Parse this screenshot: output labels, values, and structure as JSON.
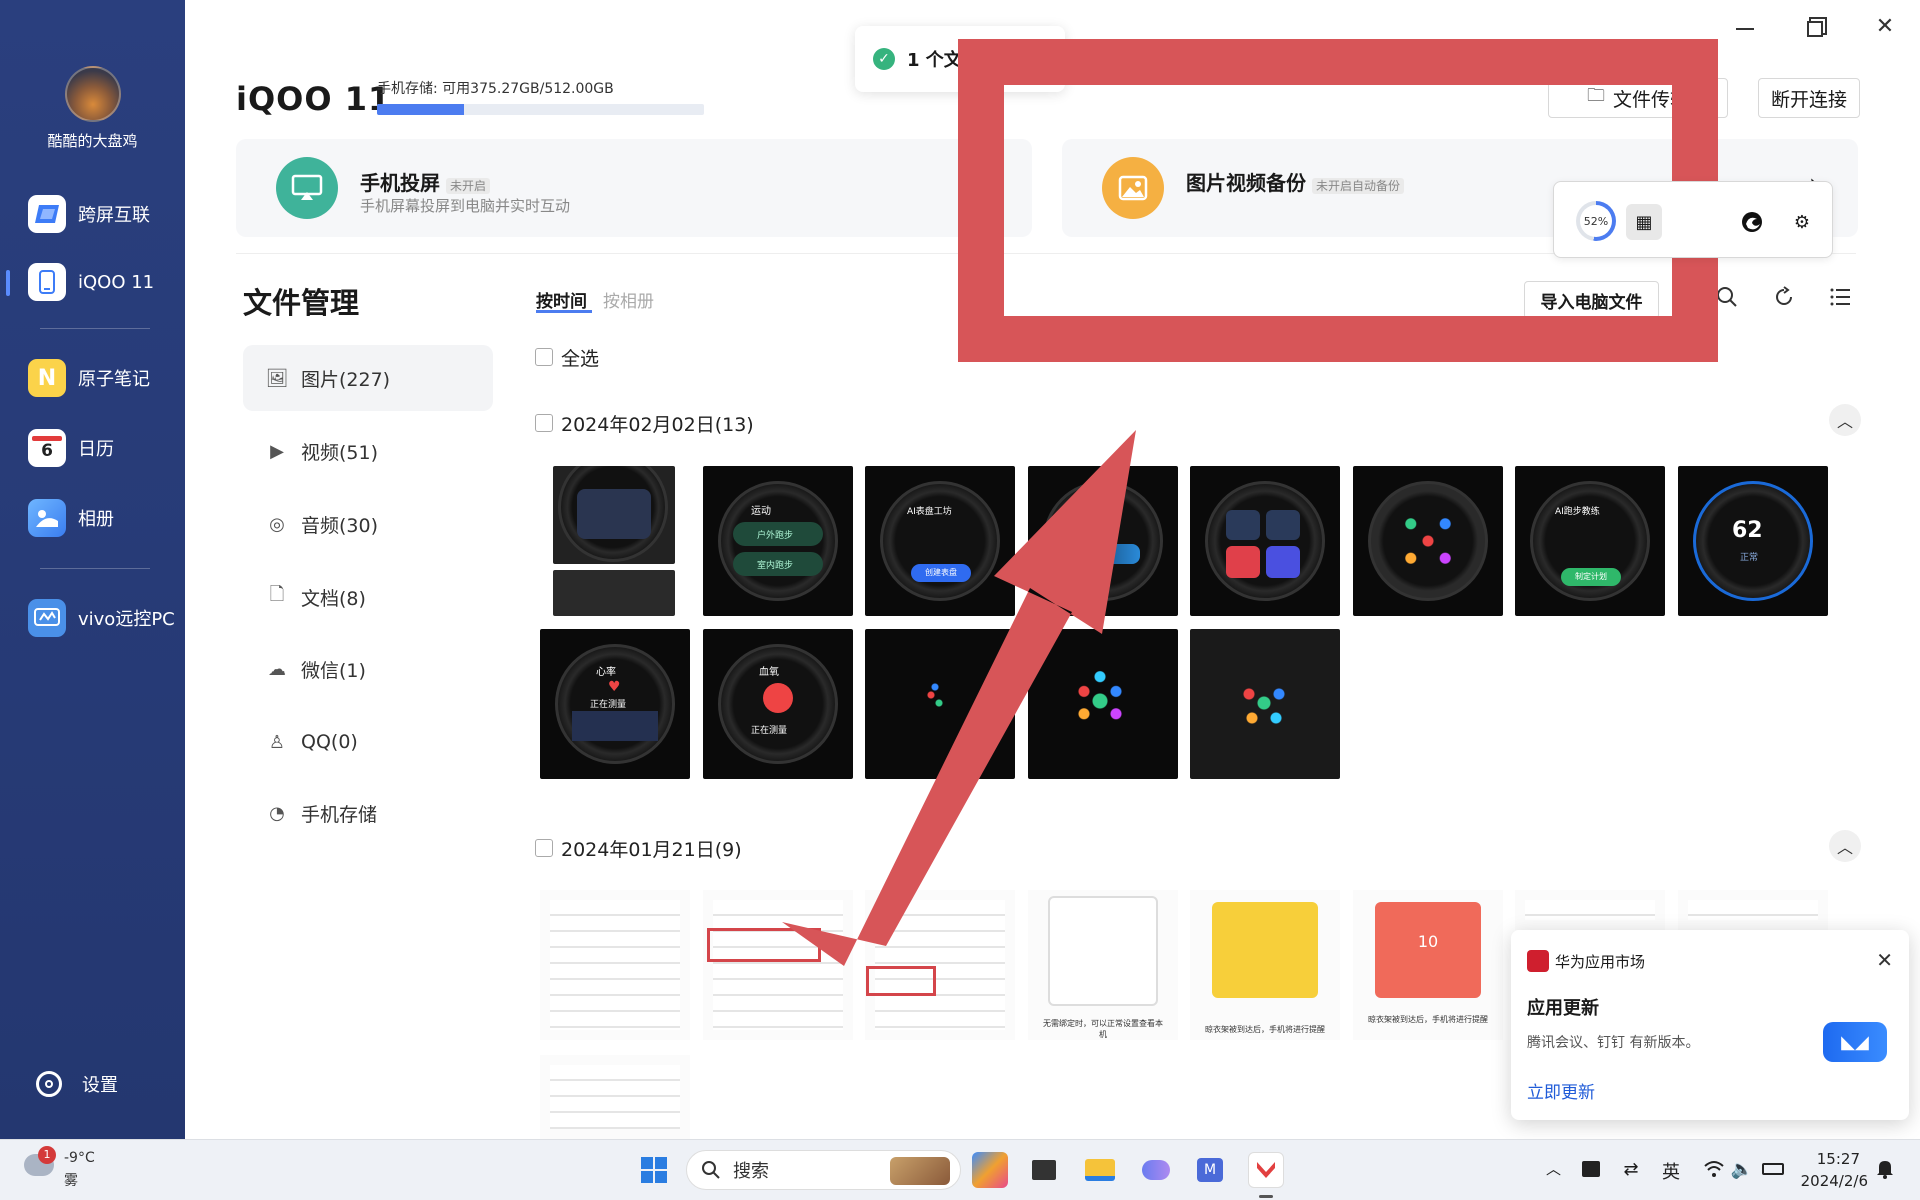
{
  "sidebar": {
    "username": "酷酷的大盘鸡",
    "items": [
      {
        "label": "跨屏互联",
        "icon": "cross-screen-icon"
      },
      {
        "label": "iQOO 11",
        "icon": "phone-icon"
      },
      {
        "label": "原子笔记",
        "icon": "notes-icon"
      },
      {
        "label": "日历",
        "icon": "calendar-icon",
        "day": "6"
      },
      {
        "label": "相册",
        "icon": "album-icon"
      },
      {
        "label": "vivo远控PC",
        "icon": "remote-pc-icon"
      }
    ],
    "settings_label": "设置"
  },
  "header": {
    "device_name": "iQOO 11",
    "storage_text": "手机存储: 可用375.27GB/512.00GB",
    "storage_used_fraction": 0.267,
    "file_transfer_label": "文件传输",
    "disconnect_label": "断开连接"
  },
  "toast": {
    "text": "1 个文"
  },
  "cards": {
    "screen_mirror": {
      "title": "手机投屏",
      "badge": "未开启",
      "subtitle": "手机屏幕投屏到电脑并实时互动"
    },
    "backup": {
      "title": "图片视频备份",
      "badge": "未开启自动备份"
    }
  },
  "popup": {
    "percent": "52%"
  },
  "file_manager": {
    "title": "文件管理",
    "items": [
      {
        "label": "图片(227)"
      },
      {
        "label": "视频(51)"
      },
      {
        "label": "音频(30)"
      },
      {
        "label": "文档(8)"
      },
      {
        "label": "微信(1)"
      },
      {
        "label": "QQ(0)"
      },
      {
        "label": "手机存储"
      }
    ]
  },
  "main": {
    "tabs": [
      {
        "label": "按时间"
      },
      {
        "label": "按相册"
      }
    ],
    "import_label": "导入电脑文件",
    "select_all": "全选",
    "groups": [
      {
        "date": "2024年02月02日(13)"
      },
      {
        "date": "2024年01月21日(9)"
      }
    ],
    "watch_texts": {
      "run": "运动",
      "outdoor": "户外跑步",
      "indoor": "室内跑步",
      "ai_face": "AI表盘工坊",
      "ai_face_btn": "创建表盘",
      "ai_run": "AI跑步教练",
      "ai_run_btn": "制定计划",
      "steps_value": "62",
      "steps_status": "正常",
      "heart": "心率",
      "heart_status": "正在测量",
      "spo2": "血氧",
      "spo2_status": "正在测量"
    },
    "doc_captions": [
      "无需绑定时，可以正常设置查看本机",
      "晾衣架被到达后，手机将进行提醒"
    ],
    "doc_timer": "10"
  },
  "notification": {
    "app_name": "华为应用市场",
    "title": "应用更新",
    "body": "腾讯会议、钉钉 有新版本。",
    "action": "立即更新"
  },
  "taskbar": {
    "weather_temp": "-9°C",
    "weather_desc": "雾",
    "weather_badge": "1",
    "search_placeholder": "搜索",
    "ime": "英",
    "time": "15:27",
    "date": "2024/2/6"
  },
  "colors": {
    "sidebar_bg": "#2a3f7e",
    "accent": "#4c7cf0",
    "annotation_red": "#d75558",
    "mirror_green": "#3fb39a",
    "backup_orange": "#f5b042"
  }
}
